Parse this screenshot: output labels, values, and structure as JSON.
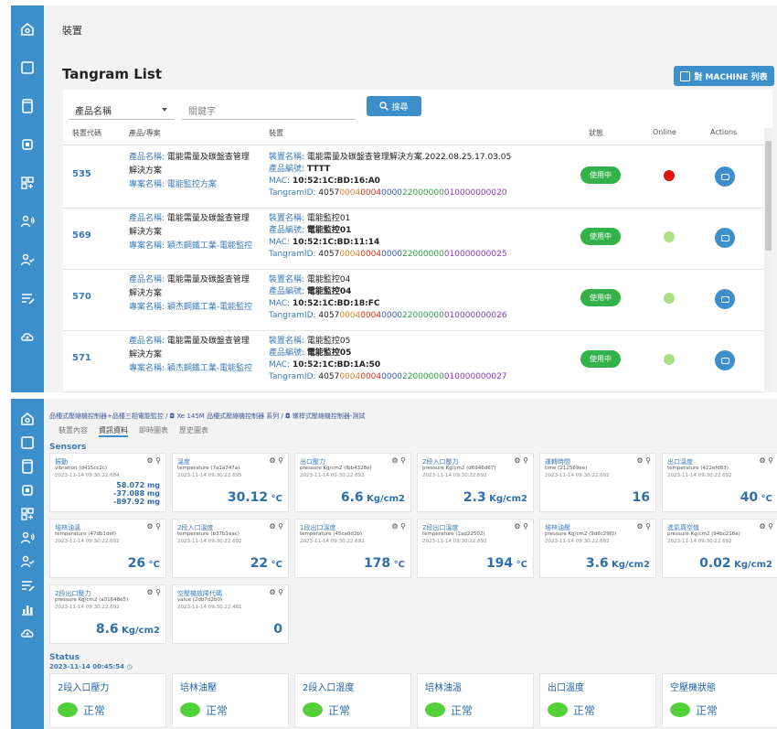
{
  "colors": {
    "accent": "#3d8fcc",
    "status_green": "#33b249",
    "offline_red": "#e01212",
    "online_green": "#a9e085"
  },
  "sidebar_icons": [
    "home-icon",
    "square-icon",
    "tablet-icon",
    "chip-icon",
    "grid-plus-icon",
    "user-wifi-icon",
    "user-check-icon",
    "list-edit-icon",
    "cloud-icon"
  ],
  "sidebar2_icons": [
    "home-icon",
    "square-icon",
    "tablet-icon",
    "chip-icon",
    "grid-plus-icon",
    "user-wifi-icon",
    "user-check-icon",
    "list-edit-icon",
    "chart-icon",
    "cloud-icon"
  ],
  "page1": {
    "breadcrumb": "裝置",
    "title": "Tangram List",
    "machine_button": "對 MACHINE 列表",
    "filter": {
      "select_value": "產品名稱",
      "keyword_placeholder": "關鍵字",
      "search_label": "搜尋"
    },
    "columns": {
      "code": "裝置代碼",
      "product": "產品/專案",
      "device": "裝置",
      "status": "狀態",
      "online": "Online",
      "actions": "Actions"
    },
    "labels": {
      "product_name": "產品名稱:",
      "project_name": "專案名稱:",
      "device_name": "裝置名稱:",
      "product_code": "產品編號:",
      "mac": "MAC:",
      "tangram_id": "TangramID:"
    },
    "rows": [
      {
        "code": "535",
        "product": "電能需量及碳盤查管理解決方案",
        "project": "電能監控方案",
        "device_name": "電能需量及碳盤查管理解決方案.2022.08.25.17.03.05",
        "device_code": "TTTT",
        "mac": "10:52:1C:BD:16:A0",
        "tid": [
          "4057",
          "0004",
          "0004",
          "0000",
          "22",
          "000000",
          "010000000",
          "020"
        ],
        "status": "使用中",
        "online": false
      },
      {
        "code": "569",
        "product": "電能需量及碳盤查管理解決方案",
        "project": "穎杰鋼鐵工業-電能監控",
        "device_name": "電能監控01",
        "device_code": "電能監控01",
        "mac": "10:52:1C:BD:11:14",
        "tid": [
          "4057",
          "0004",
          "0004",
          "0000",
          "22",
          "000000",
          "010000000",
          "025"
        ],
        "status": "使用中",
        "online": true
      },
      {
        "code": "570",
        "product": "電能需量及碳盤查管理解決方案",
        "project": "穎杰鋼鐵工業-電能監控",
        "device_name": "電能監控04",
        "device_code": "電能監控04",
        "mac": "10:52:1C:BD:18:FC",
        "tid": [
          "4057",
          "0004",
          "0004",
          "0000",
          "22",
          "000000",
          "010000000",
          "026"
        ],
        "status": "使用中",
        "online": true
      },
      {
        "code": "571",
        "product": "電能需量及碳盤查管理解決方案",
        "project": "穎杰鋼鐵工業-電能監控",
        "device_name": "電能監控05",
        "device_code": "電能監控05",
        "mac": "10:52:1C:BD:1A:50",
        "tid": [
          "4057",
          "0004",
          "0004",
          "0000",
          "22",
          "000000",
          "010000000",
          "027"
        ],
        "status": "使用中",
        "online": true
      }
    ]
  },
  "page2": {
    "breadcrumb": "品種式壓縮機控制器+品種三相電能監控 / ◘ Xe 145M 品種式壓縮機控制器 系列 / ◘ 螺桿式壓縮機控制器-測試",
    "tabs": [
      "裝置內容",
      "資訊資料",
      "即時圖表",
      "歷史圖表"
    ],
    "active_tab": 1,
    "sensors_title": "Sensors",
    "status_title": "Status",
    "status_time": "2023-11-14 00:45:54 ◷",
    "sensors": [
      {
        "name": "振動",
        "sub": "vibration (d415cc2c)",
        "time": "2023-11-14 09:30:22.684",
        "values": [
          "58.072 mg",
          "-37.088 mg",
          "-897.92 mg"
        ]
      },
      {
        "name": "溫度",
        "sub": "temperature (7a1a747a)",
        "time": "2023-11-14 09:30:22.695",
        "value": "30.12",
        "unit": "°C"
      },
      {
        "name": "出口壓力",
        "sub": "pressure Kg/cm2 (fbb4328e)",
        "time": "2023-11-14 09:30:22.692",
        "value": "6.6",
        "unit": "Kg/cm2"
      },
      {
        "name": "2段入口壓力",
        "sub": "pressure Kg/cm2 (d6946d67)",
        "time": "2023-11-14 09:30:22.692",
        "value": "2.3",
        "unit": "Kg/cm2"
      },
      {
        "name": "運轉時間",
        "sub": "time (212569ee)",
        "time": "2023-11-14 09:30:22.692",
        "value": "16",
        "unit": ""
      },
      {
        "name": "出口溫度",
        "sub": "temperature (422efd83)",
        "time": "2023-11-14 09:30:22.692",
        "value": "40",
        "unit": "°C"
      },
      {
        "name": "培林油溫",
        "sub": "temperature (47db1def)",
        "time": "2023-11-14 09:30:22.692",
        "value": "26",
        "unit": "°C"
      },
      {
        "name": "2段入口溫度",
        "sub": "temperature (b37b1eac)",
        "time": "2023-11-14 09:30:22.692",
        "value": "22",
        "unit": "°C"
      },
      {
        "name": "1段出口溫度",
        "sub": "temperature (45ca0d3b)",
        "time": "2023-11-14 09:30:22.692",
        "value": "178",
        "unit": "°C"
      },
      {
        "name": "2段出口溫度",
        "sub": "temperature (1ad22502)",
        "time": "2023-11-14 09:30:22.692",
        "value": "194",
        "unit": "°C"
      },
      {
        "name": "培林油壓",
        "sub": "pressure Kg/cm2 (9d6c29f0)",
        "time": "2023-11-14 09:30:22.692",
        "value": "3.6",
        "unit": "Kg/cm2"
      },
      {
        "name": "進氣真空值",
        "sub": "pressure Kg/cm2 (94bc216e)",
        "time": "2023-11-14 09:30:22.692",
        "value": "0.02",
        "unit": "Kg/cm2"
      },
      {
        "name": "2段出口壓力",
        "sub": "pressure Kg/cm2 (a01648e5)",
        "time": "2023-11-14 09:30:22.692",
        "value": "8.6",
        "unit": "Kg/cm2"
      },
      {
        "name": "空壓機故障代碼",
        "sub": "value (2db7d2b0)",
        "time": "2023-11-14 09:30:22.461",
        "value": "0",
        "unit": ""
      }
    ],
    "statuses": [
      {
        "name": "2段入口壓力",
        "state": "正常"
      },
      {
        "name": "培林油壓",
        "state": "正常"
      },
      {
        "name": "2段入口溫度",
        "state": "正常"
      },
      {
        "name": "培林油溫",
        "state": "正常"
      },
      {
        "name": "出口溫度",
        "state": "正常"
      },
      {
        "name": "空壓機狀態",
        "state": "正常"
      }
    ]
  }
}
